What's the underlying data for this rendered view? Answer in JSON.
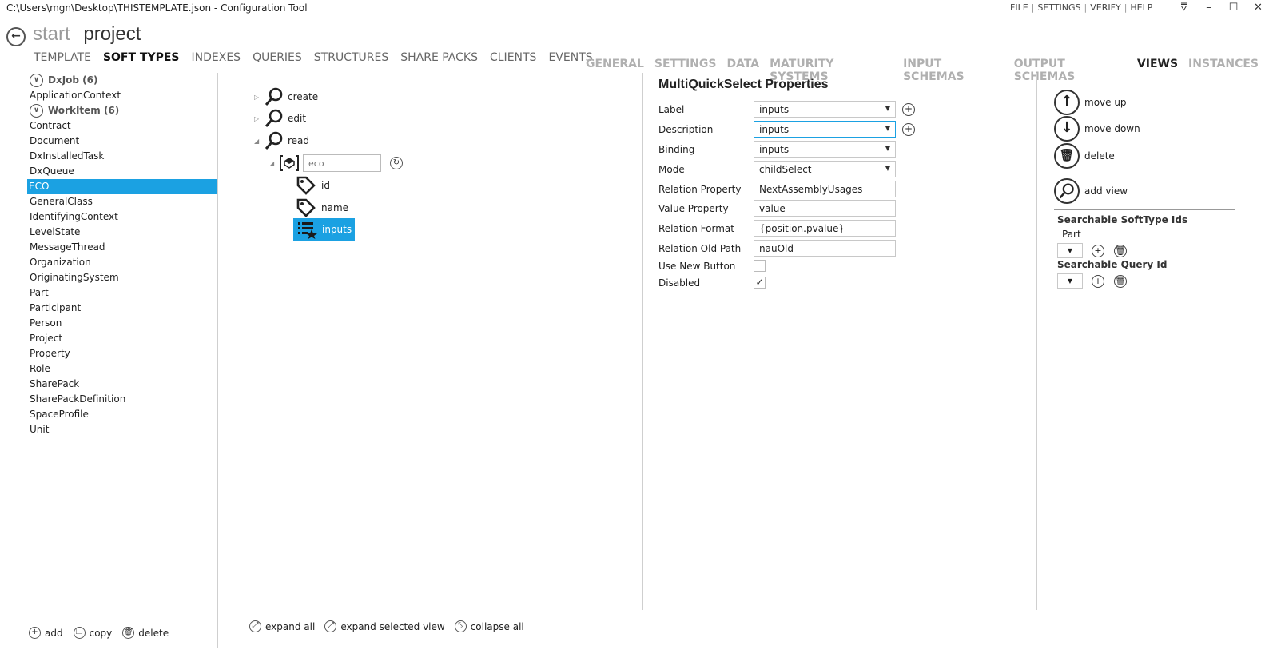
{
  "window": {
    "title": "C:\\Users\\mgn\\Desktop\\THISTEMPLATE.json - Configuration Tool",
    "menu": [
      "FILE",
      "SETTINGS",
      "VERIFY",
      "HELP"
    ],
    "controls": [
      "⩢",
      "–",
      "☐",
      "✕"
    ]
  },
  "breadcrumb": {
    "start": "start",
    "project": "project"
  },
  "main_tabs": [
    {
      "label": "TEMPLATE",
      "active": false
    },
    {
      "label": "SOFT TYPES",
      "active": true
    },
    {
      "label": "INDEXES",
      "active": false
    },
    {
      "label": "QUERIES",
      "active": false
    },
    {
      "label": "STRUCTURES",
      "active": false
    },
    {
      "label": "SHARE PACKS",
      "active": false
    },
    {
      "label": "CLIENTS",
      "active": false
    },
    {
      "label": "EVENTS",
      "active": false
    }
  ],
  "sub_tabs": [
    {
      "label": "GENERAL",
      "active": false
    },
    {
      "label": "SETTINGS",
      "active": false
    },
    {
      "label": "DATA",
      "active": false
    },
    {
      "label": "MATURITY SYSTEMS",
      "active": false
    },
    {
      "label": "INPUT SCHEMAS",
      "active": false
    },
    {
      "label": "OUTPUT SCHEMAS",
      "active": false
    },
    {
      "label": "VIEWS",
      "active": true
    },
    {
      "label": "INSTANCES",
      "active": false
    }
  ],
  "soft_types": [
    {
      "label": "DxJob (6)",
      "group": true
    },
    {
      "label": "ApplicationContext"
    },
    {
      "label": "WorkItem (6)",
      "group": true
    },
    {
      "label": "Contract"
    },
    {
      "label": "Document"
    },
    {
      "label": "DxInstalledTask"
    },
    {
      "label": "DxQueue"
    },
    {
      "label": "ECO",
      "selected": true
    },
    {
      "label": "GeneralClass"
    },
    {
      "label": "IdentifyingContext"
    },
    {
      "label": "LevelState"
    },
    {
      "label": "MessageThread"
    },
    {
      "label": "Organization"
    },
    {
      "label": "OriginatingSystem"
    },
    {
      "label": "Part"
    },
    {
      "label": "Participant"
    },
    {
      "label": "Person"
    },
    {
      "label": "Project"
    },
    {
      "label": "Property"
    },
    {
      "label": "Role"
    },
    {
      "label": "SharePack"
    },
    {
      "label": "SharePackDefinition"
    },
    {
      "label": "SpaceProfile"
    },
    {
      "label": "Unit"
    }
  ],
  "left_footer": {
    "add": "add",
    "copy": "copy",
    "delete": "delete"
  },
  "tree": {
    "create": "create",
    "edit": "edit",
    "read": "read",
    "eco_placeholder": "eco",
    "id": "id",
    "name": "name",
    "inputs": "inputs"
  },
  "tree_footer": {
    "expand_all": "expand all",
    "expand_selected": "expand selected view",
    "collapse_all": "collapse all"
  },
  "properties": {
    "title": "MultiQuickSelect Properties",
    "label_lbl": "Label",
    "label_val": "inputs",
    "description_lbl": "Description",
    "description_val": "inputs",
    "binding_lbl": "Binding",
    "binding_val": "inputs",
    "mode_lbl": "Mode",
    "mode_val": "childSelect",
    "relprop_lbl": "Relation Property",
    "relprop_val": "NextAssemblyUsages",
    "valprop_lbl": "Value Property",
    "valprop_val": "value",
    "relformat_lbl": "Relation Format",
    "relformat_val": "{position.pvalue}",
    "reloldpath_lbl": "Relation Old Path",
    "reloldpath_val": "nauOld",
    "usenew_lbl": "Use New Button",
    "usenew_checked": false,
    "disabled_lbl": "Disabled",
    "disabled_checked": true,
    "check_mark": "✓"
  },
  "right": {
    "move_up": "move up",
    "move_down": "move down",
    "delete": "delete",
    "add_view": "add view",
    "searchable_softtype_label": "Searchable SoftType Ids",
    "softtype_entry": "Part",
    "searchable_query_label": "Searchable Query Id"
  },
  "colors": {
    "accent": "#1ba1e2"
  }
}
